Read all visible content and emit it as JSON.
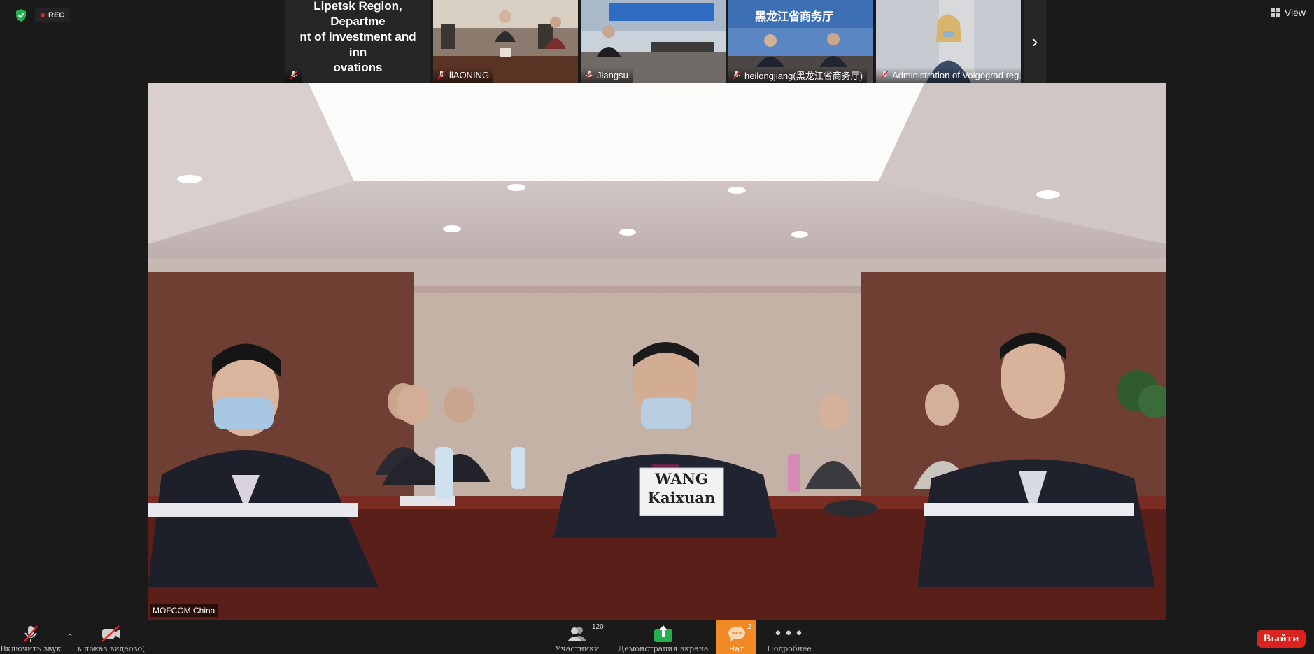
{
  "status": {
    "rec_label": "REC"
  },
  "view": {
    "label": "View"
  },
  "filmstrip": [
    {
      "kind": "name",
      "display_lines": [
        "Lipetsk Region, Departme",
        "nt of investment and inn",
        "ovations"
      ]
    },
    {
      "kind": "video",
      "name": "llAONING"
    },
    {
      "kind": "video",
      "name": "Jiangsu"
    },
    {
      "kind": "video",
      "name": "heilongjiang(黑龙江省商务厅)",
      "banner": "黑龙江省商务厅"
    },
    {
      "kind": "video",
      "name": "Administration of Volgograd reg..."
    }
  ],
  "main_video": {
    "speaker_name": "MOFCOM China",
    "nameplate_line1": "WANG",
    "nameplate_line2": "Kaixuan"
  },
  "toolbar": {
    "audio_label": "Включить звук",
    "video_label": "ь показ видеозо(",
    "participants_label": "Участники",
    "participants_count": "120",
    "share_label": "Демонстрация экрана",
    "chat_label": "Чат",
    "chat_badge": "2",
    "more_label": "Подробнее",
    "leave_label": "Выйти"
  },
  "colors": {
    "share_green": "#23b14d",
    "chat_orange": "#f08a24",
    "leave_red": "#d9231f",
    "rec_red": "#e02828"
  }
}
